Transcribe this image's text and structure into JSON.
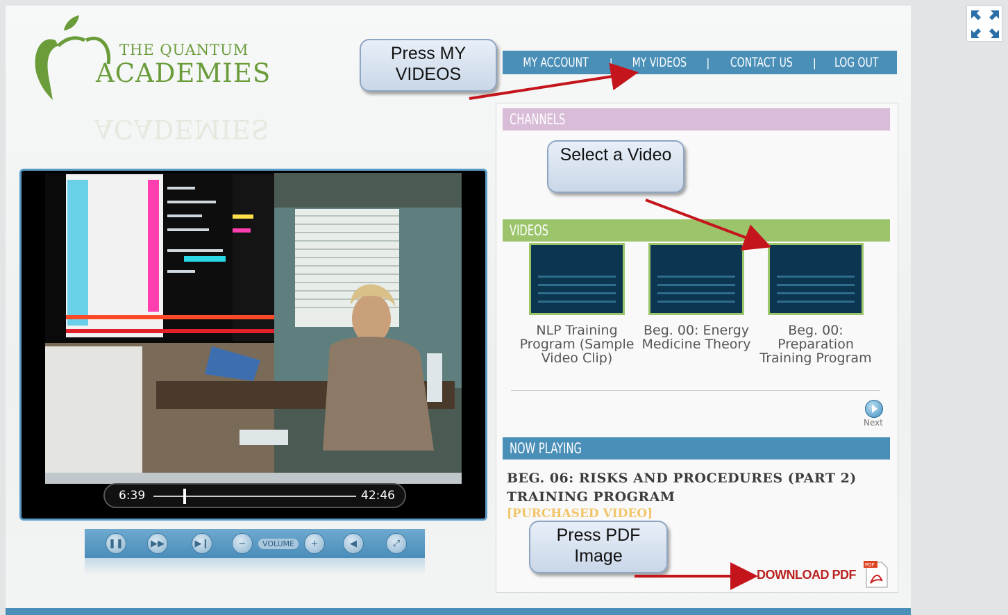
{
  "logo": {
    "line1": "THE QUANTUM",
    "line2": "ACADEMIES"
  },
  "nav": {
    "items": [
      "MY ACCOUNT",
      "MY VIDEOS",
      "CONTACT US",
      "LOG OUT"
    ]
  },
  "callouts": {
    "my_videos": "Press MY VIDEOS",
    "select_video": "Select a Video",
    "pdf": "Press PDF Image"
  },
  "player": {
    "current_time": "6:39",
    "total_time": "42:46",
    "progress": 0.155,
    "volume_label": "VOLUME",
    "controls": [
      "pause-icon",
      "fast-forward-icon",
      "skip-next-icon",
      "volume-down-icon",
      "volume-up-icon",
      "mute-icon",
      "fullscreen-icon"
    ]
  },
  "panel": {
    "channels_header": "CHANNELS",
    "videos_header": "VIDEOS",
    "videos": [
      {
        "title": "NLP Training Program (Sample Video Clip)"
      },
      {
        "title": "Beg. 00: Energy Medicine Theory"
      },
      {
        "title": "Beg. 00: Preparation Training Program"
      }
    ],
    "next_label": "Next",
    "now_playing_header": "NOW PLAYING",
    "now_playing_title": "BEG. 06: RISKS AND PROCEDURES (PART 2) TRAINING PROGRAM",
    "now_playing_status": "[PURCHASED VIDEO]",
    "download_label": "DOWNLOAD PDF",
    "pdf_icon_text": "PDF"
  },
  "colors": {
    "nav_blue": "#4a8fb8",
    "channels_header": "#d9bcd8",
    "videos_header": "#9cc46b",
    "logo_green": "#6a9c3a",
    "arrow_red": "#c4151c"
  }
}
